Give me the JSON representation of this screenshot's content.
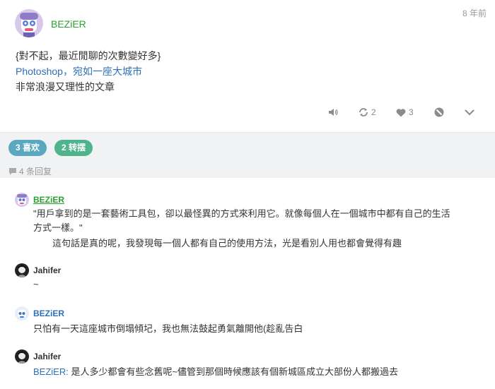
{
  "post": {
    "author": "BEZiER",
    "time": "8 年前",
    "lines": [
      "{對不起，最近閒聊的次數變好多}",
      "Photoshop，宛如一座大城市",
      "非常浪漫又理性的文章"
    ],
    "actions": {
      "repost_count": "2",
      "like_count": "3"
    }
  },
  "tags": {
    "likes": "3 喜欢",
    "reposts": "2 转摆"
  },
  "reply_count": "4 条回复",
  "replies": [
    {
      "author": "BEZiER",
      "line1": "\"用戶拿到的是一套藝術工具包，卻以最怪異的方式來利用它。就像每個人在一個城市中都有自己的生活",
      "line2": "方式一樣。\"",
      "line3": "這句話是真的呢，我發現每一個人都有自己的使用方法，光是看別人用也都會覺得有趣"
    },
    {
      "author": "Jahifer",
      "text": "~"
    },
    {
      "author": "BEZiER",
      "text": "只怕有一天這座城市倒塌傾圮，我也無法鼓起勇氣離開他(趁亂告白"
    },
    {
      "author": "Jahifer",
      "mention": "BEZiER:",
      "text": " 是人多少都會有些念舊呢~儘管到那個時候應該有個新城區成立大部份人都搬過去"
    }
  ],
  "colors": {
    "author_green": "#2aa12f",
    "link_blue": "#2f6fb7",
    "tag_like": "#5aa7c0",
    "tag_repost": "#4fb38e"
  }
}
